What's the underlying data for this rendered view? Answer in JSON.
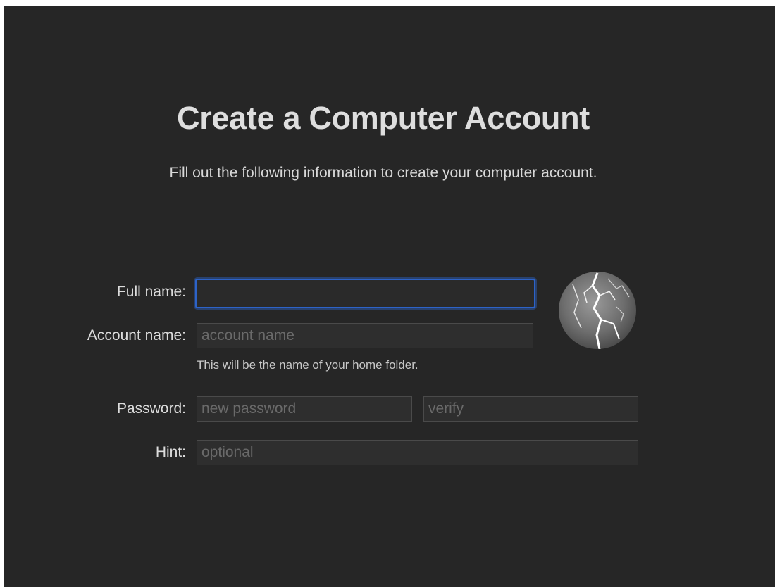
{
  "page": {
    "title": "Create a Computer Account",
    "subtitle": "Fill out the following information to create your computer account."
  },
  "form": {
    "full_name": {
      "label": "Full name:",
      "value": "",
      "placeholder": ""
    },
    "account_name": {
      "label": "Account name:",
      "value": "",
      "placeholder": "account name",
      "helper": "This will be the name of your home folder."
    },
    "password": {
      "label": "Password:",
      "placeholder": "new password",
      "verify_placeholder": "verify"
    },
    "hint": {
      "label": "Hint:",
      "placeholder": "optional"
    }
  },
  "avatar": {
    "icon": "lightning-icon"
  },
  "colors": {
    "background": "#262626",
    "focus_ring": "#2d63c8",
    "text": "#dcdcdc",
    "placeholder": "#6a6a6a"
  }
}
